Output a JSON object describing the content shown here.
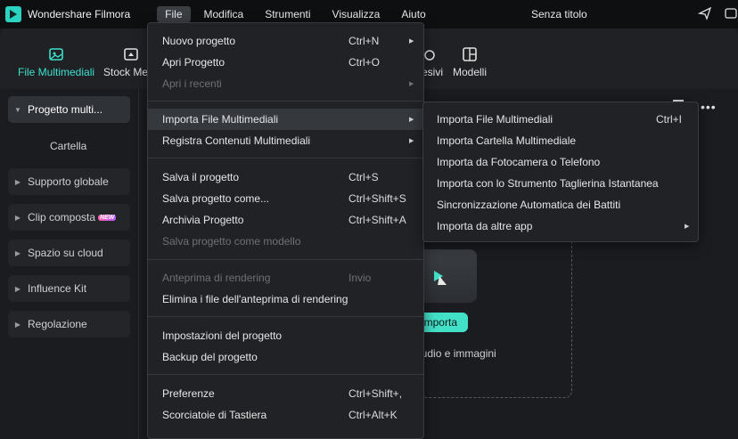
{
  "app": {
    "name": "Wondershare Filmora",
    "doc_title": "Senza titolo"
  },
  "menubar": [
    {
      "label": "File",
      "active": true
    },
    {
      "label": "Modifica"
    },
    {
      "label": "Strumenti"
    },
    {
      "label": "Visualizza"
    },
    {
      "label": "Aiuto"
    }
  ],
  "toolbar": {
    "media": "File Multimediali",
    "stock": "Stock Me",
    "effects_partial": "esivi",
    "templates": "Modelli"
  },
  "sidebar": {
    "project": "Progetto multi...",
    "folder": "Cartella",
    "items": [
      "Supporto globale",
      "Clip composta",
      "Spazio su cloud",
      "Influence Kit",
      "Regolazione"
    ],
    "new_badge": "NEW"
  },
  "content": {
    "import_button": "mporta",
    "hint": "audio e immagini"
  },
  "file_menu": {
    "new_project": {
      "label": "Nuovo progetto",
      "shortcut": "Ctrl+N"
    },
    "open_project": {
      "label": "Apri Progetto",
      "shortcut": "Ctrl+O"
    },
    "recent": {
      "label": "Apri i recenti"
    },
    "import_media": {
      "label": "Importa File Multimediali"
    },
    "record_media": {
      "label": "Registra Contenuti Multimediali"
    },
    "save": {
      "label": "Salva il progetto",
      "shortcut": "Ctrl+S"
    },
    "save_as": {
      "label": "Salva progetto come...",
      "shortcut": "Ctrl+Shift+S"
    },
    "archive": {
      "label": "Archivia Progetto",
      "shortcut": "Ctrl+Shift+A"
    },
    "save_template": {
      "label": "Salva progetto come modello"
    },
    "render_preview": {
      "label": "Anteprima di rendering",
      "shortcut": "Invio"
    },
    "delete_render": {
      "label": "Elimina i file dell'anteprima di rendering"
    },
    "project_settings": {
      "label": "Impostazioni del progetto"
    },
    "backup": {
      "label": "Backup del progetto"
    },
    "preferences": {
      "label": "Preferenze",
      "shortcut": "Ctrl+Shift+,"
    },
    "shortcuts": {
      "label": "Scorciatoie di Tastiera",
      "shortcut": "Ctrl+Alt+K"
    }
  },
  "import_submenu": {
    "import_files": {
      "label": "Importa File Multimediali",
      "shortcut": "Ctrl+I"
    },
    "import_folder": {
      "label": "Importa Cartella Multimediale"
    },
    "import_camera": {
      "label": "Importa da Fotocamera o Telefono"
    },
    "instant_cutter": {
      "label": "Importa con lo Strumento Taglierina Istantanea"
    },
    "beat_sync": {
      "label": "Sincronizzazione Automatica dei Battiti"
    },
    "other_apps": {
      "label": "Importa da altre app"
    }
  },
  "colors": {
    "accent": "#43e0c8",
    "menu_bg": "#202226",
    "hover": "#35383d"
  }
}
